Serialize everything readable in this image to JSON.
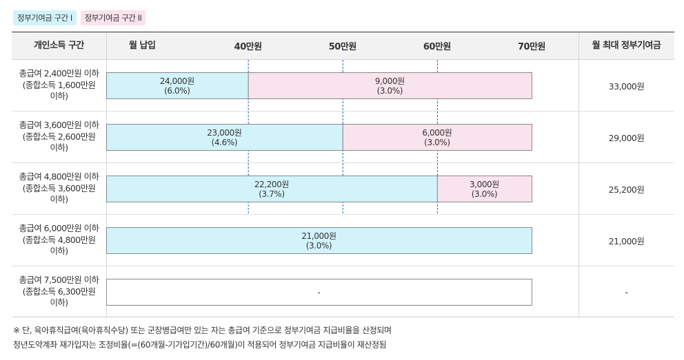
{
  "legend": {
    "segment1": "정부기여금 구간 I",
    "segment2": "정부기여금 구간 II"
  },
  "header": {
    "income": "개인소득 구간",
    "contribution": "월 납입",
    "max": "월 최대 정부기여금"
  },
  "rows": [
    {
      "label": "총급여 2,400만원 이하\n(종합소득 1,600만원\n이하)",
      "max": "33,000원"
    },
    {
      "label": "총급여 3,600만원 이하\n(종합소득 2,600만원\n이하)",
      "max": "29,000원"
    },
    {
      "label": "총급여 4,800만원 이하\n(종합소득 3,600만원\n이하)",
      "max": "25,200원"
    },
    {
      "label": "총급여 6,000만원 이하\n(종합소득 4,800만원\n이하)",
      "max": "21,000원"
    },
    {
      "label": "총급여 7,500만원 이하\n(종합소득 6,300만원\n이하)",
      "max": "-"
    }
  ],
  "chart_data": {
    "type": "bar",
    "orientation": "horizontal",
    "stacked": true,
    "xlabel": "월 납입",
    "x_ticks": [
      {
        "value": 40,
        "label": "40만원"
      },
      {
        "value": 50,
        "label": "50만원"
      },
      {
        "value": 60,
        "label": "60만원"
      },
      {
        "value": 70,
        "label": "70만원"
      }
    ],
    "xlim": [
      25,
      70
    ],
    "categories": [
      "총급여 2,400만원 이하",
      "총급여 3,600만원 이하",
      "총급여 4,800만원 이하",
      "총급여 6,000만원 이하",
      "총급여 7,500만원 이하"
    ],
    "series": [
      {
        "name": "정부기여금 구간 I",
        "color": "#d3f3fb",
        "segments": [
          {
            "from": 25,
            "to": 40,
            "line1": "24,000원",
            "line2": "(6.0%)"
          },
          {
            "from": 25,
            "to": 50,
            "line1": "23,000원",
            "line2": "(4.6%)"
          },
          {
            "from": 25,
            "to": 60,
            "line1": "22,200원",
            "line2": "(3.7%)"
          },
          {
            "from": 25,
            "to": 70,
            "line1": "21,000원",
            "line2": "(3.0%)"
          },
          {
            "from": 25,
            "to": 70,
            "line1": "-",
            "line2": "",
            "empty": true
          }
        ]
      },
      {
        "name": "정부기여금 구간 II",
        "color": "#f9e3ec",
        "segments": [
          {
            "from": 40,
            "to": 70,
            "line1": "9,000원",
            "line2": "(3.0%)"
          },
          {
            "from": 50,
            "to": 70,
            "line1": "6,000원",
            "line2": "(3.0%)"
          },
          {
            "from": 60,
            "to": 70,
            "line1": "3,000원",
            "line2": "(3.0%)"
          },
          null,
          null
        ]
      }
    ]
  },
  "notes": {
    "line1": "※ 단, 육아휴직급여(육아휴직수당) 또는 군장병급여만 있는 자는 총급여 기준으로 정부기여금 지급비율을 산정되며",
    "line2": "청년도약계좌 재가입자는 조정비율(=(60개월-기가입기간)/60개월)이 적용되어 정부기여금 지급비율이 재산정됨"
  }
}
